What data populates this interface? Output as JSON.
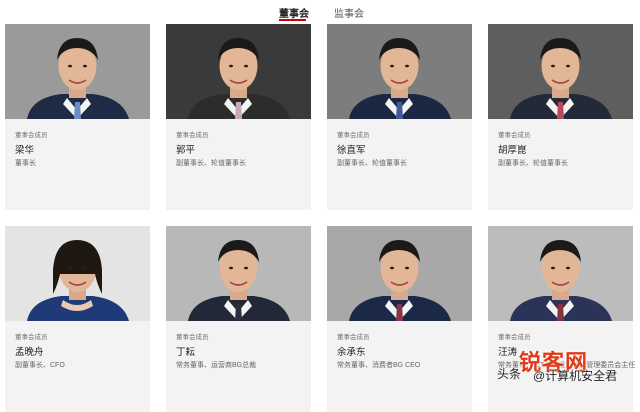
{
  "tabs": {
    "board": "董事会",
    "supervisory": "监事会",
    "active": "board"
  },
  "members": [
    {
      "role": "董事会成员",
      "name": "梁华",
      "title": "董事长",
      "bg": "#9a9a9a",
      "suit": "#1f2a44",
      "tie": "#6a8fc4"
    },
    {
      "role": "董事会成员",
      "name": "郭平",
      "title": "副董事长、轮值董事长",
      "bg": "#3a3a3a",
      "suit": "#2c2c2c",
      "tie": "#c9a8b8"
    },
    {
      "role": "董事会成员",
      "name": "徐直军",
      "title": "副董事长、轮值董事长",
      "bg": "#7d7d7d",
      "suit": "#1c2742",
      "tie": "#3e5a9a"
    },
    {
      "role": "董事会成员",
      "name": "胡厚崑",
      "title": "副董事长、轮值董事长",
      "bg": "#5e5e5e",
      "suit": "#222a3a",
      "tie": "#b8485a"
    },
    {
      "role": "董事会成员",
      "name": "孟晚舟",
      "title": "副董事长、CFO",
      "bg": "#e4e4e4",
      "suit": "#1e3a78",
      "tie": ""
    },
    {
      "role": "董事会成员",
      "name": "丁耘",
      "title": "常务董事、运营商BG总裁",
      "bg": "#b8b8b8",
      "suit": "#232838",
      "tie": "#2a2f3f"
    },
    {
      "role": "董事会成员",
      "name": "余承东",
      "title": "常务董事、消费者BG CEO",
      "bg": "#a8a8a8",
      "suit": "#1c2848",
      "tie": "#8a3448"
    },
    {
      "role": "董事会成员",
      "name": "汪涛",
      "title": "常务董事、ICT基础设施业务管理委员会主任",
      "bg": "#bcbcbc",
      "suit": "#2a3458",
      "tie": "#8a3040"
    }
  ],
  "watermark": {
    "big": "锐客网",
    "small": "头条",
    "sub": "@计算机安全君"
  }
}
